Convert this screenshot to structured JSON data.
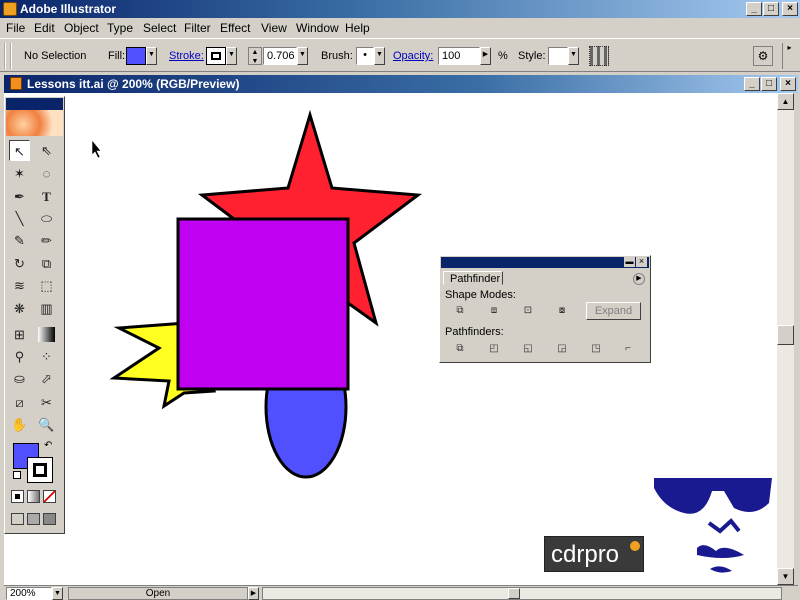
{
  "app": {
    "title": "Adobe Illustrator"
  },
  "menu": [
    "File",
    "Edit",
    "Object",
    "Type",
    "Select",
    "Filter",
    "Effect",
    "View",
    "Window",
    "Help"
  ],
  "control": {
    "selection": "No Selection",
    "fill_label": "Fill:",
    "stroke_label": "Stroke:",
    "stroke_weight": "0.706",
    "brush_label": "Brush:",
    "brush_value": "•",
    "opacity_label": "Opacity:",
    "opacity_value": "100",
    "percent": "%",
    "style_label": "Style:",
    "fill_color": "#5050ff"
  },
  "document": {
    "title": "Lessons itt.ai @ 200% (RGB/Preview)"
  },
  "pathfinder": {
    "tab": "Pathfinder",
    "shape_modes_label": "Shape Modes:",
    "expand_label": "Expand",
    "pathfinders_label": "Pathfinders:"
  },
  "status": {
    "zoom": "200%",
    "state": "Open"
  },
  "watermark": {
    "logo": "cdrpro"
  },
  "shapes": {
    "star_red": "#ff2030",
    "square": "#c000f0",
    "star_yellow": "#ffff20",
    "ellipse": "#5050ff"
  }
}
